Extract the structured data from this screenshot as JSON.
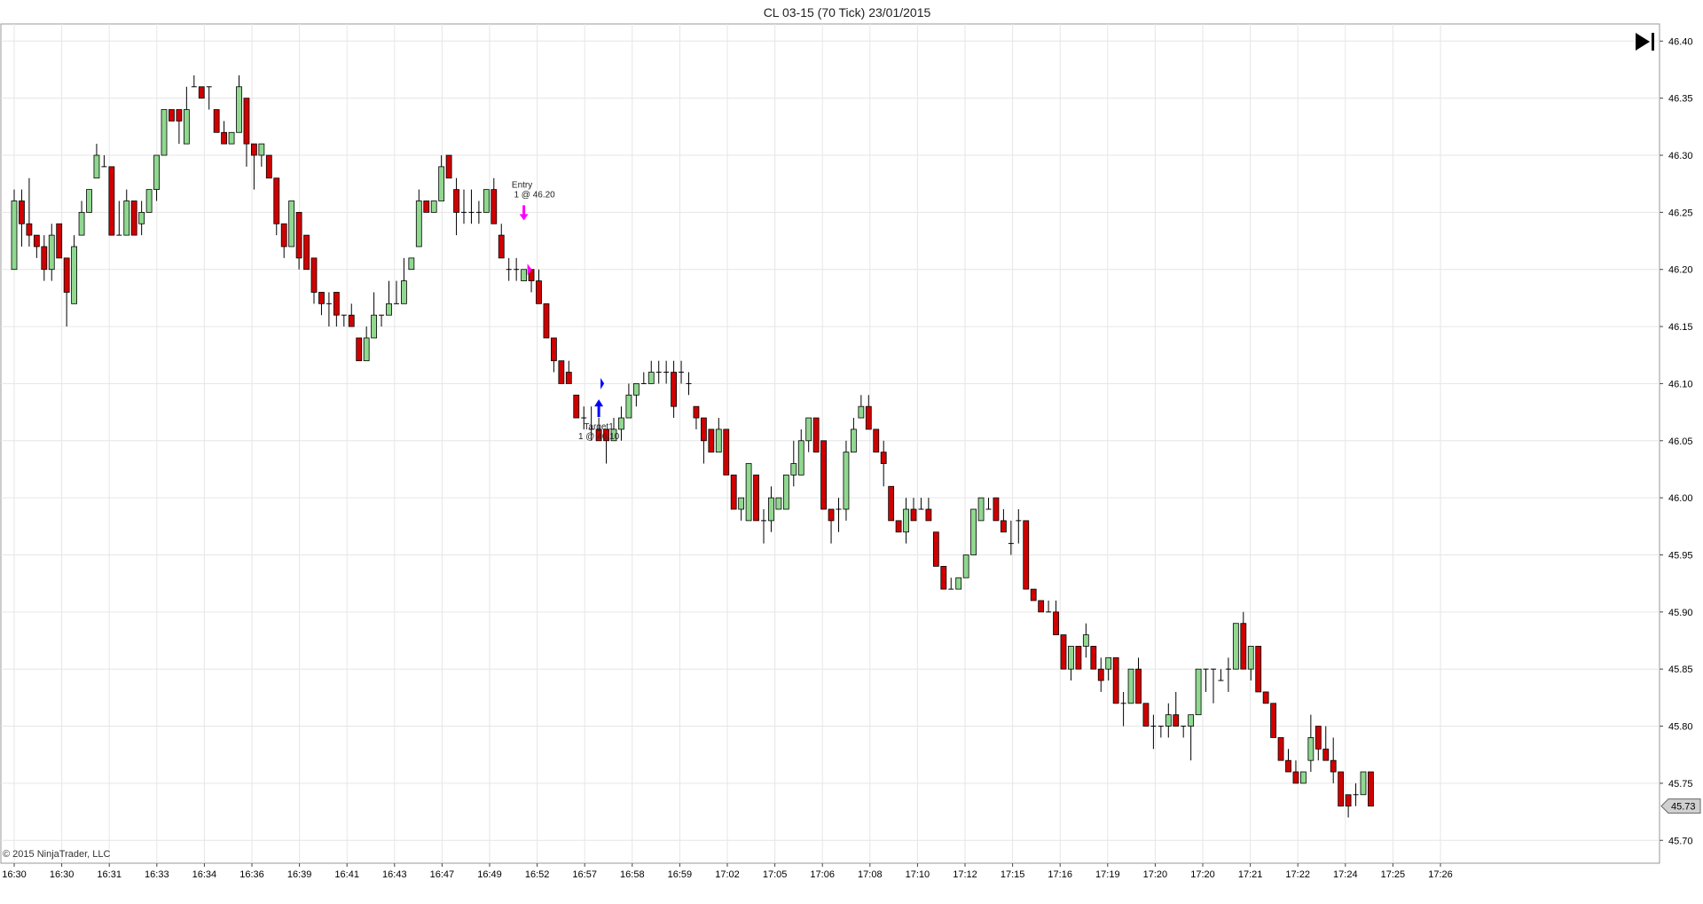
{
  "chart_data": {
    "type": "candlestick",
    "title": "CL 03-15 (70 Tick)  23/01/2015",
    "copyright": "© 2015 NinjaTrader, LLC",
    "ylim": [
      45.68,
      46.415
    ],
    "y_ticks": [
      "46.40",
      "46.35",
      "46.30",
      "46.25",
      "46.20",
      "46.15",
      "46.10",
      "46.05",
      "46.00",
      "45.95",
      "45.90",
      "45.85",
      "45.80",
      "45.75",
      "45.70"
    ],
    "x_ticks": [
      "16:30",
      "16:30",
      "16:31",
      "16:33",
      "16:34",
      "16:36",
      "16:39",
      "16:41",
      "16:43",
      "16:47",
      "16:49",
      "16:52",
      "16:57",
      "16:58",
      "16:59",
      "17:02",
      "17:05",
      "17:06",
      "17:08",
      "17:10",
      "17:12",
      "17:15",
      "17:16",
      "17:19",
      "17:20",
      "17:20",
      "17:21",
      "17:22",
      "17:24",
      "17:25",
      "17:26"
    ],
    "last_price": "45.73",
    "up_color": "#90d890",
    "down_color": "#d00000",
    "grid": true,
    "candles": [
      [
        46.2,
        46.27,
        46.2,
        46.26
      ],
      [
        46.26,
        46.27,
        46.22,
        46.24
      ],
      [
        46.24,
        46.28,
        46.22,
        46.23
      ],
      [
        46.23,
        46.23,
        46.21,
        46.22
      ],
      [
        46.22,
        46.23,
        46.19,
        46.2
      ],
      [
        46.2,
        46.24,
        46.19,
        46.23
      ],
      [
        46.24,
        46.24,
        46.21,
        46.21
      ],
      [
        46.21,
        46.21,
        46.15,
        46.18
      ],
      [
        46.17,
        46.23,
        46.17,
        46.22
      ],
      [
        46.23,
        46.26,
        46.23,
        46.25
      ],
      [
        46.25,
        46.27,
        46.25,
        46.27
      ],
      [
        46.28,
        46.31,
        46.28,
        46.3
      ],
      [
        46.29,
        46.3,
        46.29,
        46.29
      ],
      [
        46.29,
        46.29,
        46.23,
        46.23
      ],
      [
        46.23,
        46.26,
        46.23,
        46.23
      ],
      [
        46.23,
        46.27,
        46.23,
        46.26
      ],
      [
        46.26,
        46.26,
        46.23,
        46.23
      ],
      [
        46.24,
        46.26,
        46.23,
        46.25
      ],
      [
        46.25,
        46.27,
        46.25,
        46.27
      ],
      [
        46.27,
        46.3,
        46.26,
        46.3
      ],
      [
        46.3,
        46.34,
        46.3,
        46.34
      ],
      [
        46.34,
        46.34,
        46.33,
        46.33
      ],
      [
        46.34,
        46.34,
        46.31,
        46.33
      ],
      [
        46.31,
        46.36,
        46.31,
        46.34
      ],
      [
        46.36,
        46.37,
        46.36,
        46.36
      ],
      [
        46.36,
        46.36,
        46.35,
        46.35
      ],
      [
        46.36,
        46.36,
        46.34,
        46.36
      ],
      [
        46.34,
        46.34,
        46.32,
        46.32
      ],
      [
        46.32,
        46.33,
        46.31,
        46.31
      ],
      [
        46.31,
        46.32,
        46.32,
        46.32
      ],
      [
        46.32,
        46.37,
        46.32,
        46.36
      ],
      [
        46.35,
        46.35,
        46.29,
        46.31
      ],
      [
        46.31,
        46.31,
        46.27,
        46.3
      ],
      [
        46.3,
        46.31,
        46.29,
        46.31
      ],
      [
        46.3,
        46.3,
        46.28,
        46.28
      ],
      [
        46.28,
        46.28,
        46.23,
        46.24
      ],
      [
        46.24,
        46.24,
        46.21,
        46.22
      ],
      [
        46.22,
        46.26,
        46.22,
        46.26
      ],
      [
        46.25,
        46.25,
        46.2,
        46.21
      ],
      [
        46.23,
        46.23,
        46.2,
        46.2
      ],
      [
        46.21,
        46.21,
        46.17,
        46.18
      ],
      [
        46.18,
        46.18,
        46.16,
        46.17
      ],
      [
        46.17,
        46.18,
        46.15,
        46.17
      ],
      [
        46.18,
        46.18,
        46.15,
        46.16
      ],
      [
        46.16,
        46.16,
        46.15,
        46.16
      ],
      [
        46.16,
        46.17,
        46.15,
        46.15
      ],
      [
        46.14,
        46.14,
        46.12,
        46.12
      ],
      [
        46.12,
        46.15,
        46.12,
        46.14
      ],
      [
        46.14,
        46.18,
        46.14,
        46.16
      ],
      [
        46.16,
        46.16,
        46.15,
        46.16
      ],
      [
        46.16,
        46.19,
        46.16,
        46.17
      ],
      [
        46.17,
        46.19,
        46.17,
        46.17
      ],
      [
        46.17,
        46.21,
        46.17,
        46.19
      ],
      [
        46.2,
        46.21,
        46.2,
        46.21
      ],
      [
        46.22,
        46.27,
        46.22,
        46.26
      ],
      [
        46.26,
        46.26,
        46.25,
        46.25
      ],
      [
        46.25,
        46.26,
        46.25,
        46.26
      ],
      [
        46.26,
        46.3,
        46.26,
        46.29
      ],
      [
        46.3,
        46.3,
        46.28,
        46.28
      ],
      [
        46.27,
        46.28,
        46.23,
        46.25
      ],
      [
        46.25,
        46.27,
        46.24,
        46.25
      ],
      [
        46.25,
        46.27,
        46.24,
        46.25
      ],
      [
        46.25,
        46.26,
        46.24,
        46.25
      ],
      [
        46.25,
        46.27,
        46.25,
        46.27
      ],
      [
        46.27,
        46.28,
        46.24,
        46.24
      ],
      [
        46.23,
        46.24,
        46.21,
        46.21
      ],
      [
        46.2,
        46.21,
        46.19,
        46.2
      ],
      [
        46.2,
        46.21,
        46.19,
        46.2
      ],
      [
        46.19,
        46.2,
        46.19,
        46.2
      ],
      [
        46.2,
        46.2,
        46.18,
        46.19
      ],
      [
        46.19,
        46.2,
        46.17,
        46.17
      ],
      [
        46.17,
        46.17,
        46.14,
        46.14
      ],
      [
        46.14,
        46.14,
        46.11,
        46.12
      ],
      [
        46.12,
        46.12,
        46.1,
        46.1
      ],
      [
        46.11,
        46.12,
        46.1,
        46.1
      ],
      [
        46.09,
        46.09,
        46.07,
        46.07
      ],
      [
        46.07,
        46.08,
        46.06,
        46.07
      ],
      [
        46.06,
        46.08,
        46.05,
        46.06
      ],
      [
        46.06,
        46.07,
        46.05,
        46.05
      ],
      [
        46.06,
        46.06,
        46.03,
        46.05
      ],
      [
        46.05,
        46.07,
        46.05,
        46.06
      ],
      [
        46.06,
        46.08,
        46.05,
        46.07
      ],
      [
        46.07,
        46.1,
        46.07,
        46.09
      ],
      [
        46.09,
        46.1,
        46.08,
        46.1
      ],
      [
        46.1,
        46.11,
        46.1,
        46.1
      ],
      [
        46.1,
        46.12,
        46.1,
        46.11
      ],
      [
        46.11,
        46.12,
        46.1,
        46.11
      ],
      [
        46.11,
        46.12,
        46.1,
        46.11
      ],
      [
        46.11,
        46.12,
        46.07,
        46.08
      ],
      [
        46.11,
        46.12,
        46.1,
        46.11
      ],
      [
        46.1,
        46.11,
        46.09,
        46.1
      ],
      [
        46.08,
        46.08,
        46.06,
        46.07
      ],
      [
        46.07,
        46.07,
        46.03,
        46.05
      ],
      [
        46.06,
        46.06,
        46.04,
        46.04
      ],
      [
        46.04,
        46.07,
        46.04,
        46.06
      ],
      [
        46.06,
        46.06,
        46.02,
        46.02
      ],
      [
        46.02,
        46.02,
        45.99,
        45.99
      ],
      [
        45.99,
        46.0,
        45.98,
        46.0
      ],
      [
        45.98,
        46.03,
        45.98,
        46.03
      ],
      [
        46.02,
        46.02,
        45.98,
        45.98
      ],
      [
        45.98,
        45.99,
        45.96,
        45.98
      ],
      [
        45.98,
        46.01,
        45.97,
        46.0
      ],
      [
        45.99,
        46.0,
        45.99,
        46.0
      ],
      [
        45.99,
        46.02,
        45.99,
        46.02
      ],
      [
        46.02,
        46.05,
        46.01,
        46.03
      ],
      [
        46.02,
        46.06,
        46.02,
        46.05
      ],
      [
        46.05,
        46.07,
        46.04,
        46.07
      ],
      [
        46.07,
        46.07,
        46.04,
        46.04
      ],
      [
        46.05,
        46.05,
        45.99,
        45.99
      ],
      [
        45.99,
        45.99,
        45.96,
        45.98
      ],
      [
        45.99,
        46.0,
        45.97,
        45.99
      ],
      [
        45.99,
        46.05,
        45.98,
        46.04
      ],
      [
        46.04,
        46.07,
        46.04,
        46.06
      ],
      [
        46.07,
        46.09,
        46.07,
        46.08
      ],
      [
        46.08,
        46.09,
        46.06,
        46.06
      ],
      [
        46.06,
        46.06,
        46.04,
        46.04
      ],
      [
        46.04,
        46.05,
        46.01,
        46.03
      ],
      [
        46.01,
        46.01,
        45.98,
        45.98
      ],
      [
        45.98,
        45.98,
        45.97,
        45.97
      ],
      [
        45.97,
        46.0,
        45.96,
        45.99
      ],
      [
        45.99,
        46.0,
        45.98,
        45.98
      ],
      [
        45.99,
        46.0,
        45.99,
        45.99
      ],
      [
        45.99,
        46.0,
        45.98,
        45.98
      ],
      [
        45.97,
        45.97,
        45.94,
        45.94
      ],
      [
        45.94,
        45.94,
        45.92,
        45.92
      ],
      [
        45.92,
        45.93,
        45.92,
        45.92
      ],
      [
        45.92,
        45.93,
        45.92,
        45.93
      ],
      [
        45.93,
        45.95,
        45.93,
        45.95
      ],
      [
        45.95,
        45.99,
        45.95,
        45.99
      ],
      [
        45.98,
        46.0,
        45.98,
        46.0
      ],
      [
        45.99,
        46.0,
        45.99,
        45.99
      ],
      [
        46.0,
        46.0,
        45.98,
        45.98
      ],
      [
        45.98,
        45.99,
        45.97,
        45.97
      ],
      [
        45.96,
        45.98,
        45.95,
        45.96
      ],
      [
        45.98,
        45.99,
        45.96,
        45.98
      ],
      [
        45.98,
        45.98,
        45.92,
        45.92
      ],
      [
        45.92,
        45.91,
        45.91,
        45.91
      ],
      [
        45.91,
        45.91,
        45.9,
        45.9
      ],
      [
        45.9,
        45.91,
        45.9,
        45.9
      ],
      [
        45.9,
        45.91,
        45.88,
        45.88
      ],
      [
        45.88,
        45.88,
        45.85,
        45.85
      ],
      [
        45.85,
        45.87,
        45.84,
        45.87
      ],
      [
        45.87,
        45.87,
        45.85,
        45.85
      ],
      [
        45.87,
        45.89,
        45.86,
        45.88
      ],
      [
        45.87,
        45.87,
        45.85,
        45.85
      ],
      [
        45.85,
        45.86,
        45.83,
        45.84
      ],
      [
        45.85,
        45.86,
        45.84,
        45.86
      ],
      [
        45.86,
        45.86,
        45.82,
        45.82
      ],
      [
        45.82,
        45.83,
        45.8,
        45.82
      ],
      [
        45.82,
        45.85,
        45.82,
        45.85
      ],
      [
        45.85,
        45.86,
        45.82,
        45.82
      ],
      [
        45.82,
        45.82,
        45.8,
        45.8
      ],
      [
        45.8,
        45.81,
        45.78,
        45.8
      ],
      [
        45.8,
        45.8,
        45.79,
        45.8
      ],
      [
        45.8,
        45.82,
        45.79,
        45.81
      ],
      [
        45.81,
        45.83,
        45.8,
        45.8
      ],
      [
        45.8,
        45.8,
        45.79,
        45.8
      ],
      [
        45.8,
        45.81,
        45.77,
        45.81
      ],
      [
        45.81,
        45.85,
        45.81,
        45.85
      ],
      [
        45.85,
        45.85,
        45.83,
        45.85
      ],
      [
        45.85,
        45.85,
        45.82,
        45.85
      ],
      [
        45.84,
        45.85,
        45.84,
        45.84
      ],
      [
        45.85,
        45.86,
        45.83,
        45.85
      ],
      [
        45.85,
        45.89,
        45.85,
        45.89
      ],
      [
        45.89,
        45.9,
        45.85,
        45.85
      ],
      [
        45.85,
        45.87,
        45.84,
        45.87
      ],
      [
        45.87,
        45.87,
        45.83,
        45.83
      ],
      [
        45.83,
        45.83,
        45.82,
        45.82
      ],
      [
        45.82,
        45.82,
        45.79,
        45.79
      ],
      [
        45.79,
        45.79,
        45.77,
        45.77
      ],
      [
        45.77,
        45.78,
        45.76,
        45.76
      ],
      [
        45.76,
        45.77,
        45.75,
        45.75
      ],
      [
        45.75,
        45.76,
        45.75,
        45.76
      ],
      [
        45.77,
        45.81,
        45.76,
        45.79
      ],
      [
        45.8,
        45.8,
        45.77,
        45.78
      ],
      [
        45.78,
        45.8,
        45.77,
        45.77
      ],
      [
        45.77,
        45.79,
        45.75,
        45.76
      ],
      [
        45.76,
        45.76,
        45.73,
        45.73
      ],
      [
        45.74,
        45.74,
        45.72,
        45.73
      ],
      [
        45.74,
        45.75,
        45.73,
        45.74
      ],
      [
        45.74,
        45.76,
        45.74,
        45.76
      ],
      [
        45.76,
        45.76,
        45.73,
        45.73
      ]
    ],
    "annotations": [
      {
        "index": 68,
        "price": 46.25,
        "direction": "short",
        "label_line1": "Entry",
        "label_line2": "1 @ 46.20",
        "color": "#ff00ff"
      },
      {
        "index": 78,
        "price": 46.08,
        "direction": "cover",
        "label_line1": "Target1",
        "label_line2": "1 @ 46.10",
        "color": "#0000ff"
      }
    ]
  }
}
